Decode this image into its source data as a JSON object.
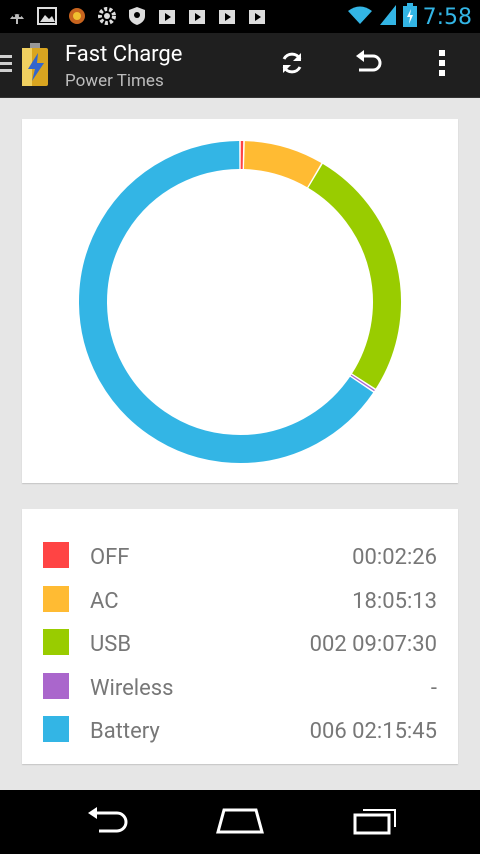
{
  "status_bar": {
    "time": "7:58",
    "icons": [
      "android-icon",
      "image-icon",
      "cog-flower-icon",
      "gear-icon",
      "shield-icon",
      "play-store-icon",
      "play-store-icon",
      "play-store-icon",
      "play-store-icon",
      "wifi-icon",
      "signal-icon",
      "battery-charging-icon"
    ]
  },
  "app_bar": {
    "title": "Fast Charge",
    "subtitle": "Power Times",
    "actions": [
      "refresh-icon",
      "undo-icon",
      "overflow-menu-icon"
    ]
  },
  "colors": {
    "off": "#ff4444",
    "ac": "#ffbb33",
    "usb": "#99cc00",
    "wireless": "#aa66cc",
    "battery": "#33b5e5"
  },
  "chart_data": {
    "type": "pie",
    "donut": true,
    "categories": [
      "OFF",
      "AC",
      "USB",
      "Wireless",
      "Battery"
    ],
    "values_seconds": [
      146,
      65113,
      205650,
      0,
      526545
    ],
    "colors": [
      "#ff4444",
      "#ffbb33",
      "#99cc00",
      "#aa66cc",
      "#33b5e5"
    ]
  },
  "legend": [
    {
      "label": "OFF",
      "value": "00:02:26",
      "color": "#ff4444"
    },
    {
      "label": "AC",
      "value": "18:05:13",
      "color": "#ffbb33"
    },
    {
      "label": "USB",
      "value": "002 09:07:30",
      "color": "#99cc00"
    },
    {
      "label": "Wireless",
      "value": "-",
      "color": "#aa66cc"
    },
    {
      "label": "Battery",
      "value": "006 02:15:45",
      "color": "#33b5e5"
    }
  ],
  "nav_bar": [
    "back-icon",
    "home-icon",
    "recents-icon"
  ]
}
